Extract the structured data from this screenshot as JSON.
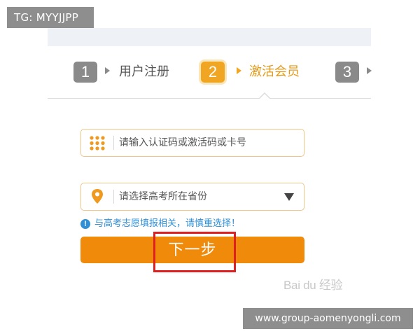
{
  "overlay": {
    "tg_label": "TG: MYYJJPP",
    "url_label": "www.group-aomenyongli.com",
    "watermark": "Bai du 经验"
  },
  "steps": [
    {
      "number": "1",
      "label": "用户注册",
      "state": "done"
    },
    {
      "number": "2",
      "label": "激活会员",
      "state": "active"
    },
    {
      "number": "3",
      "label": "",
      "state": "pending"
    }
  ],
  "form": {
    "code_field": {
      "placeholder": "请输入认证码或激活码或卡号",
      "value": "",
      "icon": "keypad-grid-icon"
    },
    "province_select": {
      "selected": "请选择高考所在省份",
      "icon": "location-pin-icon"
    },
    "hint": {
      "icon": "info-circle-icon",
      "text": "与高考志愿填报相关，请慎重选择！"
    },
    "next_button": {
      "label": "下一步"
    }
  },
  "colors": {
    "accent_orange": "#f08a0a",
    "active_step": "#f0a623",
    "hint_blue": "#2f8fd6",
    "highlight_red": "#e02020"
  }
}
